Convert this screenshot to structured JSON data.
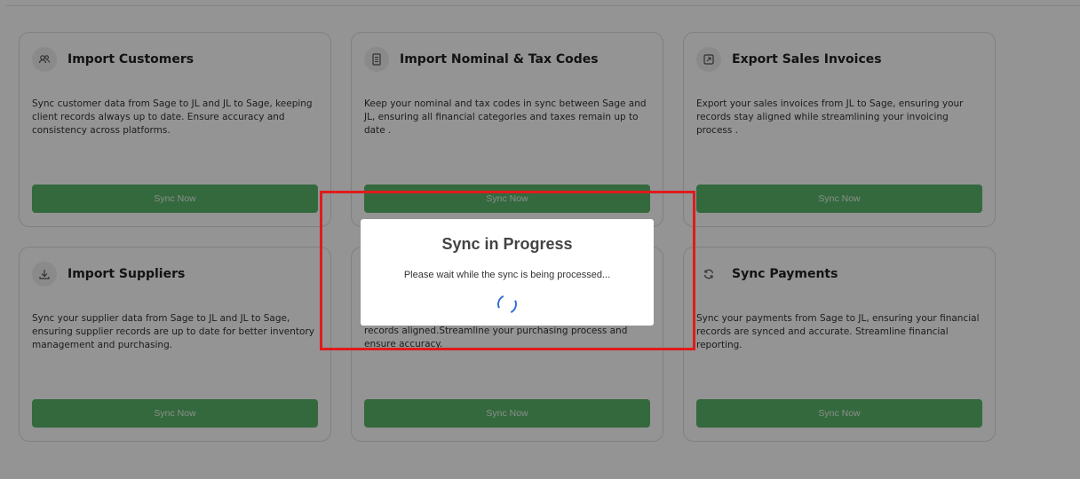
{
  "cards": [
    {
      "title": "Import Customers",
      "icon": "users-icon",
      "description": "Sync customer data from Sage to JL and JL to Sage, keeping client records always up to date. Ensure accuracy and consistency across platforms.",
      "button_label": "Sync Now"
    },
    {
      "title": "Import Nominal & Tax Codes",
      "icon": "ledger-icon",
      "description": "Keep your nominal and tax codes in sync between Sage and JL, ensuring all financial categories and taxes remain up to date .",
      "button_label": "Sync Now"
    },
    {
      "title": "Export Sales Invoices",
      "icon": "export-icon",
      "description": "Export your sales invoices from JL to Sage, ensuring your records stay aligned while streamlining your invoicing process .",
      "button_label": "Sync Now"
    },
    {
      "title": "Import Suppliers",
      "icon": "download-icon",
      "description": "Sync your supplier data from Sage to JL and JL to Sage, ensuring supplier records are up to date for better inventory management and purchasing.",
      "button_label": "Sync Now"
    },
    {
      "title": "",
      "icon": "",
      "description": "records aligned.Streamline your purchasing process and ensure accuracy.",
      "button_label": "Sync Now"
    },
    {
      "title": "Sync Payments",
      "icon": "refresh-icon",
      "description": "Sync your payments from Sage to JL, ensuring your financial records are synced and accurate. Streamline financial reporting.",
      "button_label": "Sync Now"
    }
  ],
  "modal": {
    "title": "Sync in Progress",
    "message": "Please wait while the sync is being processed..."
  },
  "colors": {
    "button_green": "#5ab66c",
    "highlight_red": "#e01b1b",
    "spinner_blue": "#2f6fd0"
  }
}
